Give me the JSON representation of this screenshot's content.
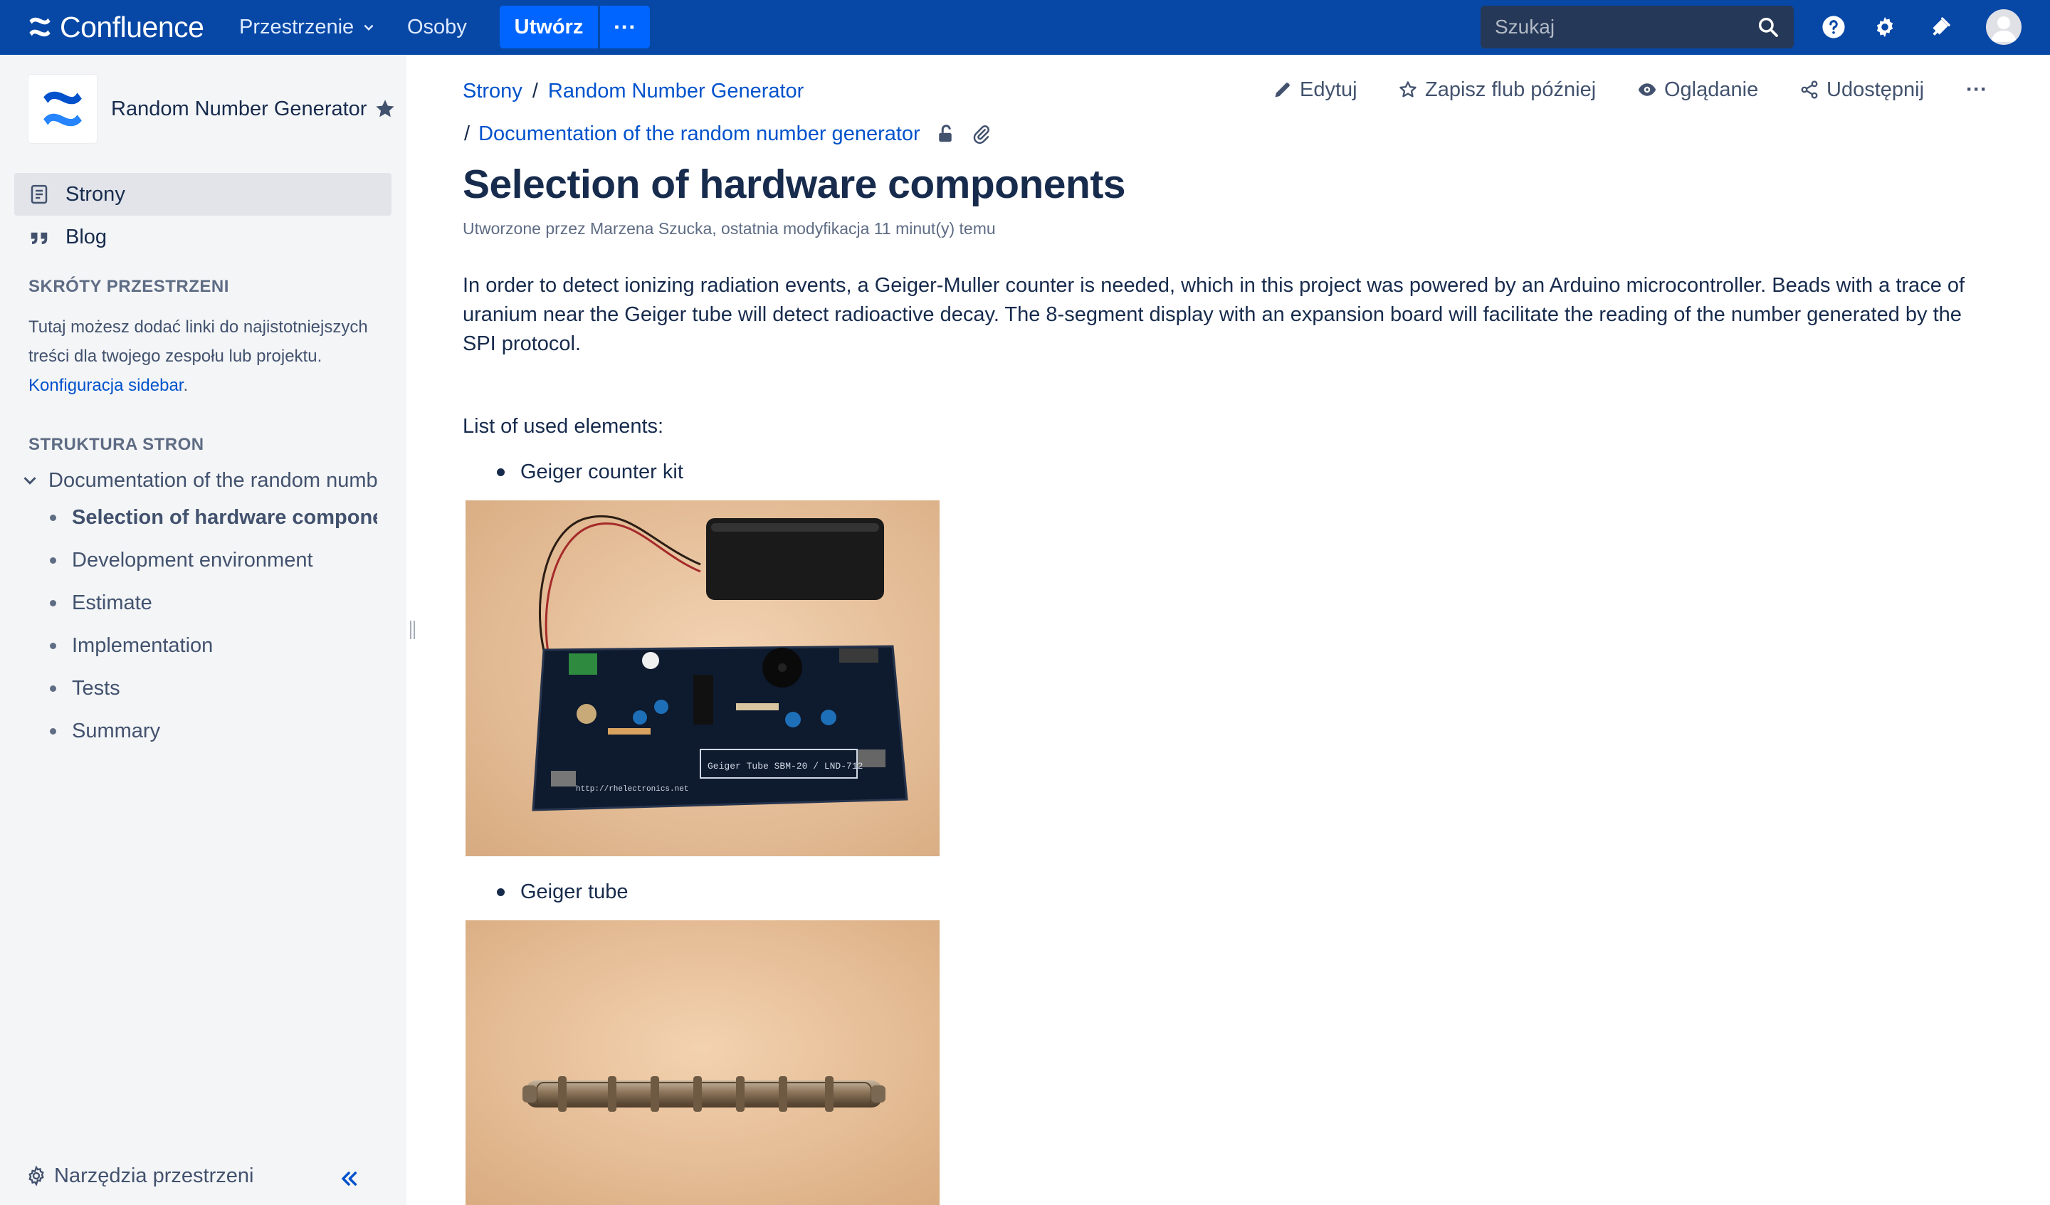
{
  "topnav": {
    "app_name": "Confluence",
    "spaces_label": "Przestrzenie",
    "people_label": "Osoby",
    "create_label": "Utwórz",
    "more_label": "···",
    "search_placeholder": "Szukaj"
  },
  "sidebar": {
    "space_name": "Random Number Generator",
    "nav": {
      "pages_label": "Strony",
      "blog_label": "Blog"
    },
    "shortcuts_heading": "SKRÓTY PRZESTRZENI",
    "shortcuts_text": "Tutaj możesz dodać linki do najistotniejszych treści dla twojego zespołu lub projektu.",
    "shortcuts_link": "Konfiguracja sidebar",
    "shortcuts_period": ".",
    "tree_heading": "STRUKTURA STRON",
    "tree_root": "Documentation of the random number generator",
    "tree_items": [
      "Selection of hardware components",
      "Development environment",
      "Estimate",
      "Implementation",
      "Tests",
      "Summary"
    ],
    "space_tools_label": "Narzędzia przestrzeni"
  },
  "breadcrumb": {
    "items": [
      "Strony",
      "Random Number Generator",
      "Documentation of the random number generator"
    ],
    "separator": "/"
  },
  "page_actions": {
    "edit": "Edytuj",
    "save_later": "Zapisz flub później",
    "watch": "Oglądanie",
    "share": "Udostępnij",
    "more": "···"
  },
  "page": {
    "title": "Selection of hardware components",
    "meta": "Utworzone przez Marzena Szucka, ostatnia modyfikacja 11 minut(y) temu",
    "intro": "In order to detect ionizing radiation events, a Geiger-Muller counter is needed, which in this project was powered by an Arduino microcontroller. Beads with a trace of uranium near the Geiger tube will detect radioactive decay. The 8-segment display with an expansion board will facilitate the reading of the number generated by the SPI protocol.",
    "list_heading": "List of used elements:",
    "elements": [
      {
        "label": "Geiger counter kit"
      },
      {
        "label": "Geiger tube"
      }
    ]
  },
  "colors": {
    "nav_bg": "#0747a6",
    "create_bg": "#0065ff",
    "link": "#0052cc",
    "text": "#172b4d",
    "sidebar_bg": "#f4f5f7"
  }
}
